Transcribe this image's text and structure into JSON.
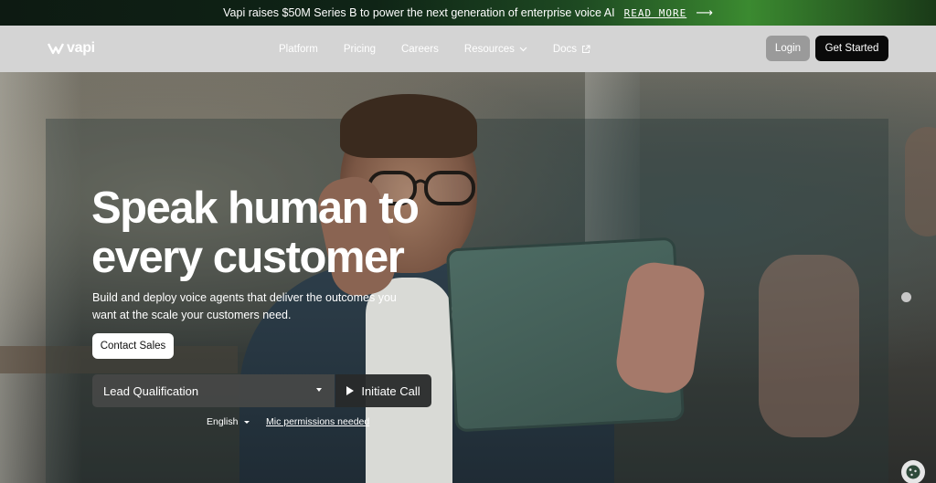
{
  "announcement": {
    "text": "Vapi raises $50M Series B to power the next generation of enterprise voice AI",
    "link_label": "READ MORE",
    "arrow_icon": "arrow-right-icon"
  },
  "nav": {
    "logo_text": "vapi",
    "items": [
      {
        "label": "Platform"
      },
      {
        "label": "Pricing"
      },
      {
        "label": "Careers"
      },
      {
        "label": "Resources",
        "icon": "chevron-down-icon"
      },
      {
        "label": "Docs",
        "icon": "external-link-icon"
      }
    ],
    "login_label": "Login",
    "get_started_label": "Get Started"
  },
  "hero": {
    "headline_line1": "Speak human to",
    "headline_line2": "every customer",
    "subtext": "Build and deploy voice agents that deliver the outcomes you want at the scale your customers need.",
    "contact_label": "Contact Sales",
    "select_value": "Lead Qualification",
    "call_label": "Initiate Call",
    "language": "English",
    "mic_label": "Mic permissions needed"
  },
  "colors": {
    "accent_green": "#3b8a30",
    "nav_bg": "#d4d4d4",
    "primary_button": "#0a0a0a"
  }
}
